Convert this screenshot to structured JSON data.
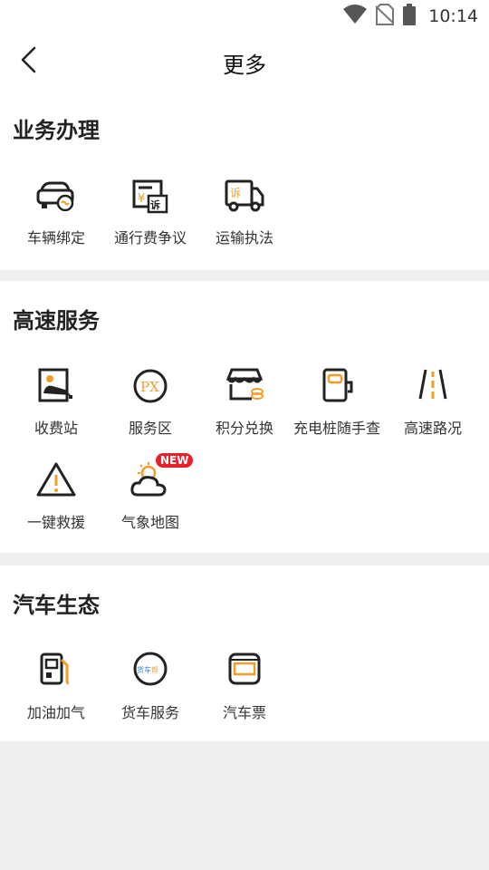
{
  "status_bar": {
    "time": "10:14",
    "icons": [
      "wifi-icon",
      "no-sim-icon",
      "battery-icon"
    ]
  },
  "header": {
    "title": "更多",
    "back_icon": "chevron-left-icon"
  },
  "colors": {
    "accent": "#f39c2a",
    "badge": "#e8202a",
    "icon_stroke": "#222222",
    "divider": "#efefef"
  },
  "sections": [
    {
      "title": "业务办理",
      "items": [
        {
          "label": "车辆绑定",
          "icon": "car-bind-icon"
        },
        {
          "label": "通行费争议",
          "icon": "toll-dispute-icon"
        },
        {
          "label": "运输执法",
          "icon": "transport-enforcement-icon"
        }
      ]
    },
    {
      "title": "高速服务",
      "items": [
        {
          "label": "收费站",
          "icon": "toll-station-icon"
        },
        {
          "label": "服务区",
          "icon": "service-area-icon"
        },
        {
          "label": "积分兑换",
          "icon": "points-store-icon"
        },
        {
          "label": "充电桩随手查",
          "icon": "charging-pile-icon"
        },
        {
          "label": "高速路况",
          "icon": "road-condition-icon"
        },
        {
          "label": "一键救援",
          "icon": "warning-icon"
        },
        {
          "label": "气象地图",
          "icon": "weather-icon",
          "badge": "NEW"
        }
      ]
    },
    {
      "title": "汽车生态",
      "items": [
        {
          "label": "加油加气",
          "icon": "fuel-pump-icon"
        },
        {
          "label": "货车服务",
          "icon": "truck-service-icon"
        },
        {
          "label": "汽车票",
          "icon": "bus-ticket-icon"
        }
      ]
    }
  ]
}
